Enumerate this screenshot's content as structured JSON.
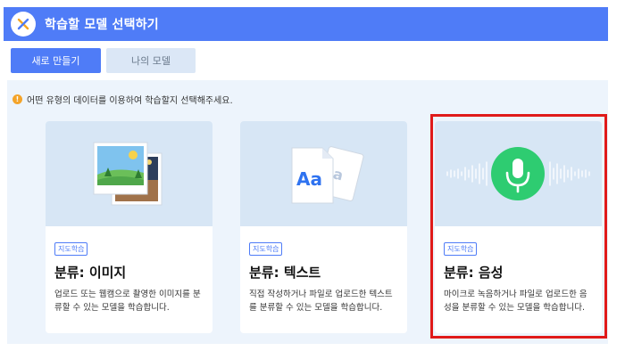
{
  "header": {
    "title": "학습할 모델 선택하기",
    "close_icon": "close-icon"
  },
  "tabs": {
    "new_label": "새로 만들기",
    "mine_label": "나의 모델"
  },
  "notice": {
    "text": "어떤 유형의 데이터를 이용하여 학습할지 선택해주세요."
  },
  "cards": [
    {
      "badge": "지도학습",
      "title": "분류: 이미지",
      "desc": "업로드 또는 웹캠으로 촬영한 이미지를 분류할 수 있는 모델을 학습합니다.",
      "icon": "image-photos-icon"
    },
    {
      "badge": "지도학습",
      "title": "분류: 텍스트",
      "desc": "직접 작성하거나 파일로 업로드한 텍스트를 분류할 수 있는 모델을 학습합니다.",
      "icon": "text-document-icon",
      "icon_text": "Aa"
    },
    {
      "badge": "지도학습",
      "title": "분류: 음성",
      "desc": "마이크로 녹음하거나 파일로 업로드한 음성을 분류할 수 있는 모델을 학습합니다.",
      "icon": "microphone-icon"
    }
  ],
  "colors": {
    "accent": "#4f7cf7",
    "mic_green": "#2ecc71",
    "highlight": "#e01a1a",
    "warning": "#f4a42a"
  }
}
